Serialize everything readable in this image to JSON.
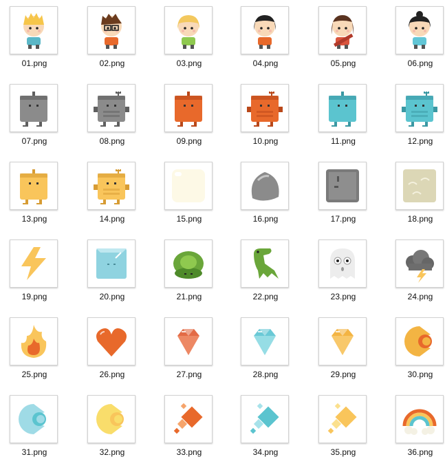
{
  "files": [
    {
      "name": "01.png",
      "icon": "boy-blonde-icon"
    },
    {
      "name": "02.png",
      "icon": "boy-glasses-icon"
    },
    {
      "name": "03.png",
      "icon": "girl-blonde-icon"
    },
    {
      "name": "04.png",
      "icon": "girl-black-hair-icon"
    },
    {
      "name": "05.png",
      "icon": "girl-guitar-icon"
    },
    {
      "name": "06.png",
      "icon": "girl-bun-icon"
    },
    {
      "name": "07.png",
      "icon": "gray-block-creature-icon"
    },
    {
      "name": "08.png",
      "icon": "gray-robot-icon"
    },
    {
      "name": "09.png",
      "icon": "orange-block-creature-icon"
    },
    {
      "name": "10.png",
      "icon": "orange-robot-icon"
    },
    {
      "name": "11.png",
      "icon": "teal-block-creature-icon"
    },
    {
      "name": "12.png",
      "icon": "teal-robot-icon"
    },
    {
      "name": "13.png",
      "icon": "yellow-block-creature-icon"
    },
    {
      "name": "14.png",
      "icon": "yellow-robot-icon"
    },
    {
      "name": "15.png",
      "icon": "cream-block-icon"
    },
    {
      "name": "16.png",
      "icon": "gray-rock-icon"
    },
    {
      "name": "17.png",
      "icon": "stone-block-icon"
    },
    {
      "name": "18.png",
      "icon": "sand-block-icon"
    },
    {
      "name": "19.png",
      "icon": "lightning-icon"
    },
    {
      "name": "20.png",
      "icon": "ice-cube-icon"
    },
    {
      "name": "21.png",
      "icon": "turtle-icon"
    },
    {
      "name": "22.png",
      "icon": "dinosaur-icon"
    },
    {
      "name": "23.png",
      "icon": "ghost-icon"
    },
    {
      "name": "24.png",
      "icon": "storm-cloud-icon"
    },
    {
      "name": "25.png",
      "icon": "fire-icon"
    },
    {
      "name": "26.png",
      "icon": "heart-icon"
    },
    {
      "name": "27.png",
      "icon": "orange-gem-icon"
    },
    {
      "name": "28.png",
      "icon": "blue-gem-icon"
    },
    {
      "name": "29.png",
      "icon": "yellow-gem-icon"
    },
    {
      "name": "30.png",
      "icon": "orange-chomper-icon"
    },
    {
      "name": "31.png",
      "icon": "blue-chomper-icon"
    },
    {
      "name": "32.png",
      "icon": "yellow-chomper-icon"
    },
    {
      "name": "33.png",
      "icon": "orange-diamond-tiles-icon"
    },
    {
      "name": "34.png",
      "icon": "blue-diamond-tiles-icon"
    },
    {
      "name": "35.png",
      "icon": "yellow-diamond-tiles-icon"
    },
    {
      "name": "36.png",
      "icon": "rainbow-icon"
    }
  ],
  "colors": {
    "orange": "#e8692b",
    "gray": "#8b8b8b",
    "teal": "#5bc4cf",
    "yellow": "#f9c55b",
    "green": "#6aa63a",
    "skin": "#f8d9b8"
  }
}
